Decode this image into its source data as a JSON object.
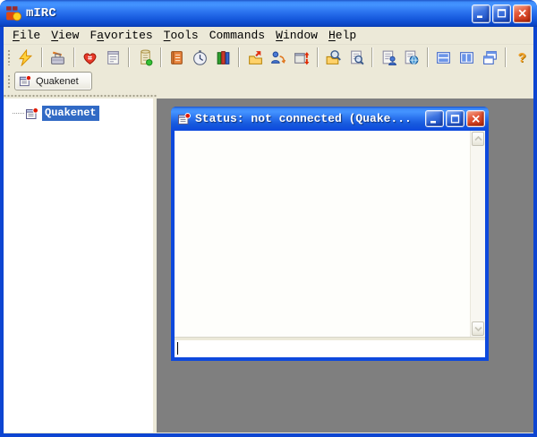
{
  "window": {
    "title": "mIRC",
    "controls": [
      "minimize",
      "maximize",
      "close"
    ]
  },
  "menu": {
    "items": [
      {
        "pre": "",
        "key": "F",
        "post": "ile"
      },
      {
        "pre": "",
        "key": "V",
        "post": "iew"
      },
      {
        "pre": "F",
        "key": "a",
        "post": "vorites"
      },
      {
        "pre": "",
        "key": "T",
        "post": "ools"
      },
      {
        "pre": "Commands",
        "key": "",
        "post": ""
      },
      {
        "pre": "",
        "key": "W",
        "post": "indow"
      },
      {
        "pre": "",
        "key": "H",
        "post": "elp"
      }
    ]
  },
  "toolbar": {
    "help_glyph": "?",
    "button_groups": [
      [
        "connect"
      ],
      [
        "options"
      ],
      [
        "favorites",
        "channels-list"
      ],
      [
        "script-editor"
      ],
      [
        "address-book",
        "timer",
        "help-books"
      ],
      [
        "send-file",
        "switch-user",
        "dcc"
      ],
      [
        "find-folder",
        "find-text"
      ],
      [
        "notify-list",
        "url-list"
      ],
      [
        "tile-horizontal",
        "tile-vertical",
        "cascade"
      ],
      [
        "help"
      ]
    ]
  },
  "switchbar": {
    "buttons": [
      {
        "label": "Quakenet",
        "icon": "status-window"
      }
    ]
  },
  "tree": {
    "items": [
      {
        "label": "Quakenet",
        "icon": "status-window",
        "selected": true
      }
    ]
  },
  "status_window": {
    "title": "Status: not connected (Quake...",
    "controls": [
      "minimize",
      "maximize",
      "close"
    ],
    "input_value": ""
  },
  "colors": {
    "titlebar_blue": "#2a72ee",
    "window_border_blue": "#0d45d1",
    "chrome_beige": "#ece9d8",
    "mdi_gray": "#7f7f7f",
    "selection_blue": "#316ac5",
    "close_button_red": "#cc3a1a",
    "content_white": "#fefefb"
  }
}
